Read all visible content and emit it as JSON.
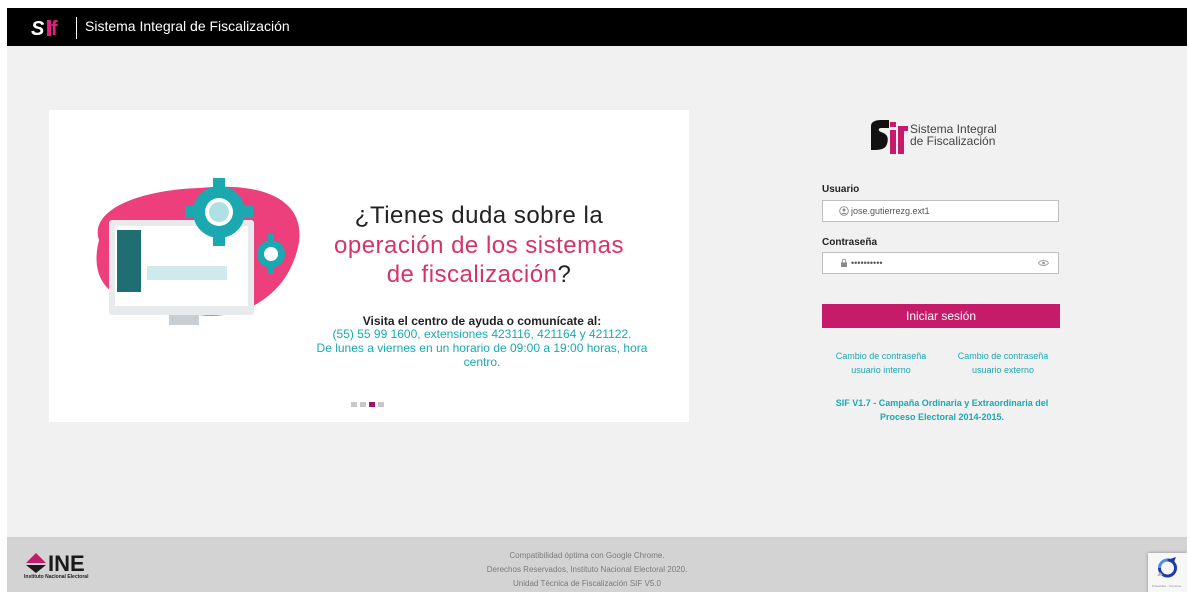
{
  "header": {
    "logo_text": "SIF",
    "title": "Sistema Integral de Fiscalización"
  },
  "slide": {
    "question_line1": "¿Tienes duda sobre la",
    "question_line2": "operación de los sistemas",
    "question_line3": "de fiscalización",
    "question_mark": "?",
    "visit_text": "Visita el centro de ayuda o comunícate al:",
    "phone_text": "(55) 55 99 1600, extensiones 423116, 421164 y 421122.",
    "hours_text": "De lunes a viernes en un horario de 09:00 a 19:00 horas, hora",
    "hours_text2": "centro.",
    "carousel_active_index": 2,
    "carousel_total": 4
  },
  "login": {
    "logo_line1": "Sistema Integral",
    "logo_line2": "de Fiscalización",
    "usuario_label": "Usuario",
    "usuario_value": "jose.gutierrezg.ext1",
    "password_label": "Contraseña",
    "password_value": "••••••••••",
    "submit_label": "Iniciar sesión",
    "link_interno_line1": "Cambio de contraseña",
    "link_interno_line2": "usuario interno",
    "link_externo_line1": "Cambio de contraseña",
    "link_externo_line2": "usuario externo",
    "version_line1": "SIF V1.7 - Campaña Ordinaria y Extraordinaria del",
    "version_line2": "Proceso Electoral 2014-2015."
  },
  "footer": {
    "ine_text": "INE",
    "ine_subtitle": "Instituto Nacional Electoral",
    "line1": "Compatibilidad óptima con Google Chrome.",
    "line2": "Derechos Reservados, Instituto Nacional Electoral 2020.",
    "line3": "Unidad Técnica de Fiscalización SIF V5.0",
    "recaptcha_text": "Privacidad - Términos"
  },
  "colors": {
    "brand_pink": "#c61b6b",
    "teal": "#1ba8b1",
    "header_bg": "#000000",
    "page_bg": "#f1f1f1",
    "footer_bg": "#d3d3d3"
  }
}
